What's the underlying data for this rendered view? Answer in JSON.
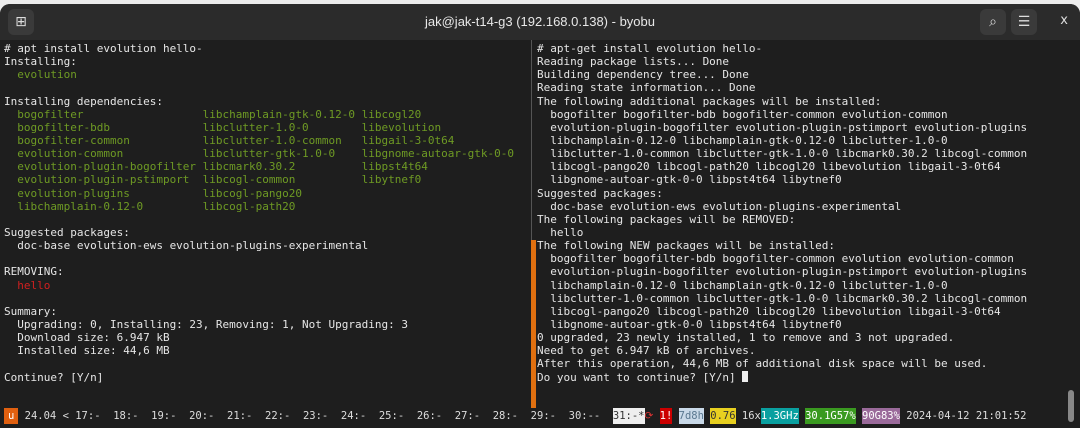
{
  "window": {
    "title": "jak@jak-t14-g3 (192.168.0.138) - byobu",
    "new_tab_icon": "new-tab-icon",
    "search_icon": "search-icon",
    "menu_icon": "menu-icon",
    "close_label": "x"
  },
  "left_pane": [
    {
      "t": "# apt install evolution hello-",
      "c": ""
    },
    {
      "t": "Installing:",
      "c": ""
    },
    {
      "t": "  evolution",
      "c": "g"
    },
    {
      "t": "",
      "c": ""
    },
    {
      "t": "Installing dependencies:",
      "c": ""
    },
    {
      "t": "  bogofilter                  libchamplain-gtk-0.12-0 libcogl20",
      "c": "g"
    },
    {
      "t": "  bogofilter-bdb              libclutter-1.0-0        libevolution",
      "c": "g"
    },
    {
      "t": "  bogofilter-common           libclutter-1.0-common   libgail-3-0t64",
      "c": "g"
    },
    {
      "t": "  evolution-common            libclutter-gtk-1.0-0    libgnome-autoar-gtk-0-0",
      "c": "g"
    },
    {
      "t": "  evolution-plugin-bogofilter libcmark0.30.2          libpst4t64",
      "c": "g"
    },
    {
      "t": "  evolution-plugin-pstimport  libcogl-common          libytnef0",
      "c": "g"
    },
    {
      "t": "  evolution-plugins           libcogl-pango20",
      "c": "g"
    },
    {
      "t": "  libchamplain-0.12-0         libcogl-path20",
      "c": "g"
    },
    {
      "t": "",
      "c": ""
    },
    {
      "t": "Suggested packages:",
      "c": ""
    },
    {
      "t": "  doc-base evolution-ews evolution-plugins-experimental",
      "c": ""
    },
    {
      "t": "",
      "c": ""
    },
    {
      "t": "REMOVING:",
      "c": ""
    },
    {
      "t": "  hello",
      "c": "r"
    },
    {
      "t": "",
      "c": ""
    },
    {
      "t": "Summary:",
      "c": ""
    },
    {
      "t": "  Upgrading: 0, Installing: 23, Removing: 1, Not Upgrading: 3",
      "c": ""
    },
    {
      "t": "  Download size: 6.947 kB",
      "c": ""
    },
    {
      "t": "  Installed size: 44,6 MB",
      "c": ""
    },
    {
      "t": "",
      "c": ""
    },
    {
      "t": "Continue? [Y/n]",
      "c": ""
    }
  ],
  "right_pane": [
    "# apt-get install evolution hello-",
    "Reading package lists... Done",
    "Building dependency tree... Done",
    "Reading state information... Done",
    "The following additional packages will be installed:",
    "  bogofilter bogofilter-bdb bogofilter-common evolution-common",
    "  evolution-plugin-bogofilter evolution-plugin-pstimport evolution-plugins",
    "  libchamplain-0.12-0 libchamplain-gtk-0.12-0 libclutter-1.0-0",
    "  libclutter-1.0-common libclutter-gtk-1.0-0 libcmark0.30.2 libcogl-common",
    "  libcogl-pango20 libcogl-path20 libcogl20 libevolution libgail-3-0t64",
    "  libgnome-autoar-gtk-0-0 libpst4t64 libytnef0",
    "Suggested packages:",
    "  doc-base evolution-ews evolution-plugins-experimental",
    "The following packages will be REMOVED:",
    "  hello",
    "The following NEW packages will be installed:",
    "  bogofilter bogofilter-bdb bogofilter-common evolution evolution-common",
    "  evolution-plugin-bogofilter evolution-plugin-pstimport evolution-plugins",
    "  libchamplain-0.12-0 libchamplain-gtk-0.12-0 libclutter-1.0-0",
    "  libclutter-1.0-common libclutter-gtk-1.0-0 libcmark0.30.2 libcogl-common",
    "  libcogl-pango20 libcogl-path20 libcogl20 libevolution libgail-3-0t64",
    "  libgnome-autoar-gtk-0-0 libpst4t64 libytnef0",
    "0 upgraded, 23 newly installed, 1 to remove and 3 not upgraded.",
    "Need to get 6.947 kB of archives.",
    "After this operation, 44,6 MB of additional disk space will be used.",
    "Do you want to continue? [Y/n] "
  ],
  "status": {
    "logo": "u",
    "release": " 24.04 < ",
    "windows": [
      "17:-",
      "18:-",
      "19:-",
      "20:-",
      "21:-",
      "22:-",
      "23:-",
      "24:-",
      "25:-",
      "26:-",
      "27:-",
      "28:-",
      "29:-",
      "30:--"
    ],
    "active_window": "31:-*",
    "bell": "⟳",
    "reboot": "1!",
    "uptime": "7d8h",
    "load": "0.76",
    "cpu": "16x",
    "cpu_freq": "1.3GHz",
    "mem": "30.1G57%",
    "disk": "90G83%",
    "datetime": "2024-04-12 21:01:52"
  }
}
